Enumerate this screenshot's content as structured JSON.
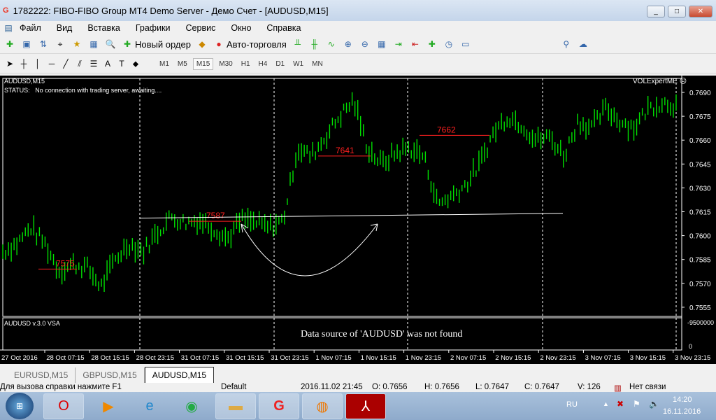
{
  "window": {
    "title": "1782222: FIBO-FIBO Group MT4 Demo Server - Демо Счет - [AUDUSD,M15]",
    "controls": [
      "_",
      "□",
      "✕"
    ]
  },
  "menu": [
    "Файл",
    "Вид",
    "Вставка",
    "Графики",
    "Сервис",
    "Окно",
    "Справка"
  ],
  "toolbar": {
    "new_order": "Новый ордер",
    "auto_trading": "Авто-торговля"
  },
  "timeframes": [
    "M1",
    "M5",
    "M15",
    "M30",
    "H1",
    "H4",
    "D1",
    "W1",
    "MN"
  ],
  "active_timeframe": "M15",
  "chart": {
    "symbol_label": "AUDUSD,M15",
    "status_label": "STATUS:",
    "status_text": "No connection with trading server, awaiting....",
    "expert": "VOLExpertME",
    "indicator_label": "AUDUSD v.3.0 VSA",
    "indicator_message": "Data source of 'AUDUSD' was not found",
    "indicator_max": "-9500000",
    "indicator_min": "0",
    "colors": {
      "bars": "#00e000",
      "levels": "#ff2020",
      "background": "#000000"
    }
  },
  "chart_data": {
    "type": "bar",
    "title": "AUDUSD,M15",
    "ylim": [
      0.7548,
      0.7697
    ],
    "y_ticks": [
      "0.7690",
      "0.7675",
      "0.7660",
      "0.7645",
      "0.7630",
      "0.7615",
      "0.7600",
      "0.7585",
      "0.7570",
      "0.7555"
    ],
    "x_ticks": [
      "27 Oct 2016",
      "28 Oct 07:15",
      "28 Oct 15:15",
      "28 Oct 23:15",
      "31 Oct 07:15",
      "31 Oct 15:15",
      "31 Oct 23:15",
      "1 Nov 07:15",
      "1 Nov 15:15",
      "1 Nov 23:15",
      "2 Nov 07:15",
      "2 Nov 15:15",
      "2 Nov 23:15",
      "3 Nov 07:15",
      "3 Nov 15:15",
      "3 Nov 23:15"
    ],
    "closes": [
      0.759,
      0.7595,
      0.7605,
      0.7595,
      0.7578,
      0.7582,
      0.758,
      0.7568,
      0.7585,
      0.7595,
      0.759,
      0.7602,
      0.7612,
      0.7608,
      0.761,
      0.7605,
      0.7598,
      0.761,
      0.7608,
      0.7605,
      0.761,
      0.7655,
      0.765,
      0.7662,
      0.7675,
      0.7685,
      0.7655,
      0.7645,
      0.7652,
      0.7655,
      0.765,
      0.762,
      0.7625,
      0.7632,
      0.7645,
      0.7665,
      0.7675,
      0.767,
      0.766,
      0.7662,
      0.765,
      0.7672,
      0.7668,
      0.768,
      0.7672,
      0.7668,
      0.768,
      0.7684,
      0.7682
    ],
    "levels": [
      {
        "label": "7575",
        "value": 0.7579
      },
      {
        "label": "7587",
        "value": 0.7609
      },
      {
        "label": "7641",
        "value": 0.765
      },
      {
        "label": "7662",
        "value": 0.7663
      }
    ],
    "trendline": [
      0.7611,
      0.7614
    ]
  },
  "tabs": [
    "EURUSD,M15",
    "GBPUSD,M15",
    "AUDUSD,M15"
  ],
  "active_tab": "AUDUSD,M15",
  "status": {
    "help": "Для вызова справки нажмите F1",
    "profile": "Default",
    "datetime": "2016.11.02 21:45",
    "open": "O: 0.7656",
    "high": "H: 0.7656",
    "low": "L: 0.7647",
    "close": "C: 0.7647",
    "volume": "V: 126",
    "connection": "Нет связи"
  },
  "taskbar": {
    "lang": "RU",
    "time": "14:20",
    "date": "16.11.2016",
    "apps": [
      "opera",
      "media-player",
      "internet-explorer",
      "chrome",
      "file-explorer",
      "fibogroup",
      "firefox",
      "acrobat"
    ]
  }
}
